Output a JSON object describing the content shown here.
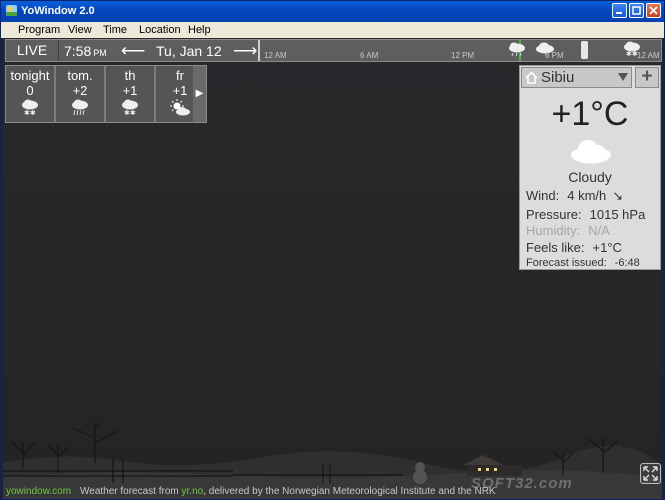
{
  "window": {
    "title": "YoWindow 2.0"
  },
  "menu": [
    "Program",
    "View",
    "Time",
    "Location",
    "Help"
  ],
  "topbar": {
    "live_label": "LIVE",
    "time": "7:58",
    "ampm": "PM",
    "date": "Tu, Jan 12",
    "timeline_labels": [
      "12 AM",
      "6 AM",
      "12 PM",
      "6 PM",
      "12 AM"
    ]
  },
  "forecast": [
    {
      "name": "tonight",
      "temp": "0",
      "icon": "snow-cloud-icon"
    },
    {
      "name": "tom.",
      "temp": "+2",
      "icon": "rain-cloud-icon"
    },
    {
      "name": "th",
      "temp": "+1",
      "icon": "snow-cloud-icon"
    },
    {
      "name": "fr",
      "temp": "+1",
      "icon": "sun-cloud-icon"
    }
  ],
  "panel": {
    "location": "Sibiu",
    "temperature": "+1°C",
    "condition": "Cloudy",
    "wind_label": "Wind:",
    "wind_value": "4 km/h",
    "wind_arrow": "↘",
    "pressure_label": "Pressure:",
    "pressure_value": "1015 hPa",
    "humidity_label": "Humidity:",
    "humidity_value": "N/A",
    "feels_label": "Feels like:",
    "feels_value": "+1°C",
    "issued_label": "Forecast issued:",
    "issued_value": "-6:48"
  },
  "status": {
    "site": "yowindow.com",
    "text_prefix": "Weather forecast from",
    "source": "yr.no",
    "text_suffix": ", delivered by the Norwegian Meteorological Institute and the NRK"
  },
  "watermark": "SOFT32.com"
}
